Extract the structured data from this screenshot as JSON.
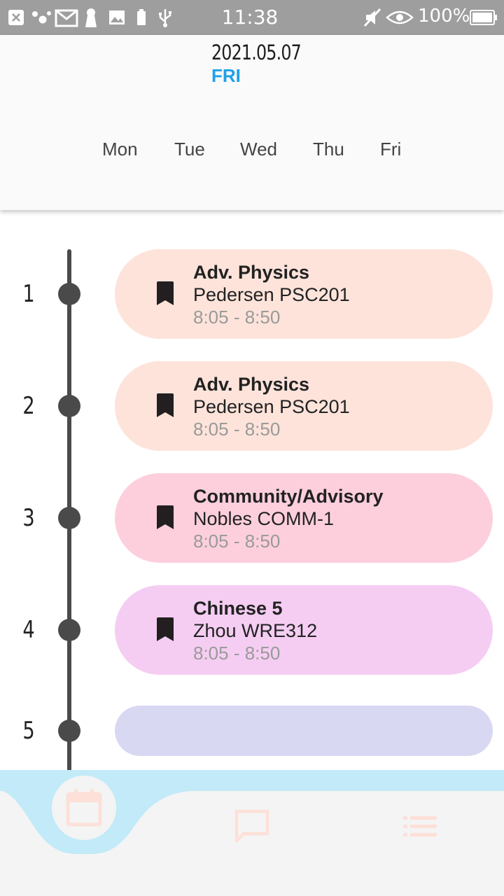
{
  "status_bar": {
    "time": "11:38",
    "battery": "100%",
    "icons": [
      "close-box-icon",
      "dots-icon",
      "mail-icon",
      "keyhole-icon",
      "image-icon",
      "battery-small-icon",
      "usb-icon",
      "mute-icon",
      "eye-icon",
      "battery-icon"
    ]
  },
  "header": {
    "date": "2021.05.07",
    "day": "FRI",
    "tabs": [
      "Mon",
      "Tue",
      "Wed",
      "Thu",
      "Fri"
    ]
  },
  "schedule": [
    {
      "period": "1",
      "title": "Adv. Physics",
      "teacher": "Pedersen PSC201",
      "time": "8:05 - 8:50",
      "color": "#fde3da"
    },
    {
      "period": "2",
      "title": "Adv. Physics",
      "teacher": "Pedersen PSC201",
      "time": "8:05 - 8:50",
      "color": "#fde3da"
    },
    {
      "period": "3",
      "title": "Community/Advisory",
      "teacher": "Nobles COMM-1",
      "time": "8:05 - 8:50",
      "color": "#fdcfdd"
    },
    {
      "period": "4",
      "title": "Chinese 5",
      "teacher": "Zhou WRE312",
      "time": "8:05 - 8:50",
      "color": "#f5cdf2"
    },
    {
      "period": "5",
      "title": "",
      "teacher": "",
      "time": "",
      "color": "#d9d8f3"
    }
  ],
  "bottom_nav": {
    "items": [
      "calendar-icon",
      "chat-icon",
      "list-icon"
    ],
    "active": "calendar-icon",
    "accent": "#c2eaf8",
    "icon_color": "#fde0d8"
  }
}
